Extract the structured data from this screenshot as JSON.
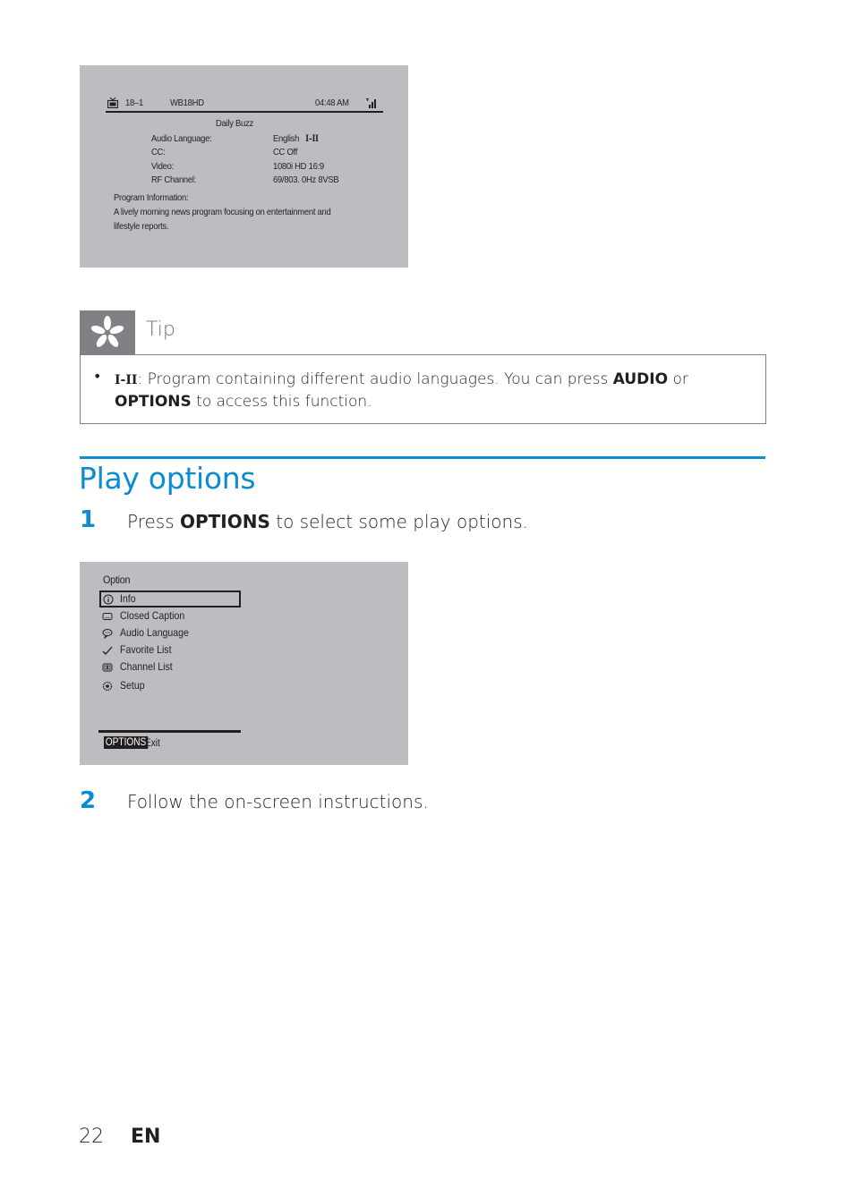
{
  "info_screen": {
    "channel_number": "18–1",
    "channel_name": "WB18HD",
    "time": "04:48 AM",
    "program_title": "Daily Buzz",
    "fields": [
      {
        "label": "Audio Language:",
        "value": "English"
      },
      {
        "label": "CC:",
        "value": "CC Off"
      },
      {
        "label": "Video:",
        "value": "1080i HD 16:9"
      },
      {
        "label": "RF Channel:",
        "value": "69/803. 0Hz 8VSB"
      }
    ],
    "audio_lang_symbol": "I–II",
    "program_info_label": "Program Information:",
    "program_info_line1": "A lively  morning news program focusing on entertainment and",
    "program_info_line2": "lifestyle reports."
  },
  "tip": {
    "title": "Tip",
    "bullet": "•",
    "symbol": "I-II",
    "text_part1": ": Program containing different audio languages. You can press ",
    "key1": "AUDIO",
    "text_part2": " or ",
    "key2": "OPTIONS",
    "text_part3": " to access this function."
  },
  "section": {
    "title": "Play options",
    "steps": [
      {
        "number": "1",
        "prefix": "Press ",
        "key": "OPTIONS",
        "suffix": " to select some play options."
      },
      {
        "number": "2",
        "text": "Follow the on-screen instructions."
      }
    ]
  },
  "options_menu": {
    "title": "Option",
    "items": [
      {
        "label": "Info",
        "icon": "info-icon",
        "selected": true
      },
      {
        "label": "Closed Caption",
        "icon": "closed-caption-icon"
      },
      {
        "label": "Audio Language",
        "icon": "speech-bubble-icon"
      },
      {
        "label": "Favorite List",
        "icon": "checkmark-icon"
      },
      {
        "label": "Channel List",
        "icon": "channel-list-icon"
      },
      {
        "label": "Setup",
        "icon": "gear-icon"
      }
    ],
    "footer_key": "OPTIONS",
    "footer_action": "Exit"
  },
  "footer": {
    "page_number": "22",
    "language": "EN"
  },
  "colors": {
    "accent": "#0b8bd0",
    "screen_bg": "#bcbdc0",
    "tip_header": "#808184"
  }
}
